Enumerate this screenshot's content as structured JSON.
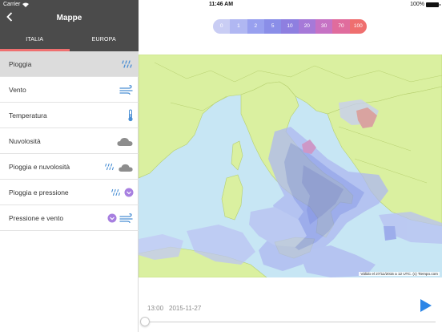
{
  "status": {
    "carrier": "Carrier",
    "time": "11:46 AM",
    "battery": "100%",
    "battery_level": 1.0
  },
  "sidebar": {
    "title": "Mappe",
    "tabs": [
      {
        "label": "ITALIA",
        "active": true
      },
      {
        "label": "EUROPA",
        "active": false
      }
    ],
    "items": [
      {
        "label": "Pioggia",
        "icons": [
          "rain-icon"
        ],
        "selected": true
      },
      {
        "label": "Vento",
        "icons": [
          "wind-icon"
        ],
        "selected": false
      },
      {
        "label": "Temperatura",
        "icons": [
          "thermometer-icon"
        ],
        "selected": false
      },
      {
        "label": "Nuvolosità",
        "icons": [
          "cloud-icon"
        ],
        "selected": false
      },
      {
        "label": "Pioggia e nuvolosità",
        "icons": [
          "rain-icon",
          "cloud-icon"
        ],
        "selected": false
      },
      {
        "label": "Pioggia e pressione",
        "icons": [
          "rain-icon",
          "pressure-icon"
        ],
        "selected": false
      },
      {
        "label": "Pressione e vento",
        "icons": [
          "pressure-icon",
          "wind-icon"
        ],
        "selected": false
      }
    ]
  },
  "legend": {
    "labels": [
      "0",
      "1",
      "2",
      "5",
      "10",
      "20",
      "30",
      "70",
      "100"
    ],
    "colors": [
      "#c9cdf4",
      "#b0b7f2",
      "#98a0ef",
      "#8a8ee8",
      "#8e7fe0",
      "#a679d8",
      "#c672c4",
      "#e06c9d",
      "#ef6f6f"
    ]
  },
  "map": {
    "validity": "Válido el 27/11/2015 a 12 UTC. (c) Tiempo.com"
  },
  "timeline": {
    "time": "13:00",
    "date": "2015-11-27",
    "progress": 0.0
  },
  "colors": {
    "header_bg": "#4b4b4b",
    "accent": "#ef6f6f",
    "play": "#2d86e6"
  }
}
